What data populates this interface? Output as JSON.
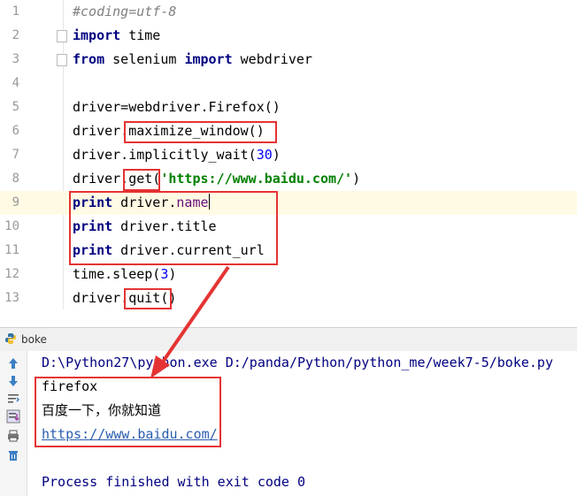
{
  "editor": {
    "lines": [
      {
        "num": "1",
        "segments": [
          {
            "t": "#coding=utf-8",
            "c": "cm"
          }
        ]
      },
      {
        "num": "2",
        "segments": [
          {
            "t": "import",
            "c": "kw"
          },
          {
            "t": " time",
            "c": ""
          }
        ]
      },
      {
        "num": "3",
        "segments": [
          {
            "t": "from",
            "c": "kw"
          },
          {
            "t": " selenium ",
            "c": ""
          },
          {
            "t": "import",
            "c": "kw"
          },
          {
            "t": " webdriver",
            "c": ""
          }
        ]
      },
      {
        "num": "4",
        "segments": []
      },
      {
        "num": "5",
        "segments": [
          {
            "t": "driver=webdriver.Firefox()",
            "c": ""
          }
        ]
      },
      {
        "num": "6",
        "segments": [
          {
            "t": "driver.maximize_window()",
            "c": ""
          }
        ]
      },
      {
        "num": "7",
        "segments": [
          {
            "t": "driver.implicitly_wait(",
            "c": ""
          },
          {
            "t": "30",
            "c": "num"
          },
          {
            "t": ")",
            "c": ""
          }
        ]
      },
      {
        "num": "8",
        "segments": [
          {
            "t": "driver.get(",
            "c": ""
          },
          {
            "t": "'https://www.baidu.com/'",
            "c": "str"
          },
          {
            "t": ")",
            "c": ""
          }
        ]
      },
      {
        "num": "9",
        "segments": [
          {
            "t": "print",
            "c": "kw"
          },
          {
            "t": " driver.",
            "c": ""
          },
          {
            "t": "name",
            "c": "attr"
          }
        ]
      },
      {
        "num": "10",
        "segments": [
          {
            "t": "print",
            "c": "kw"
          },
          {
            "t": " driver.title",
            "c": ""
          }
        ]
      },
      {
        "num": "11",
        "segments": [
          {
            "t": "print",
            "c": "kw"
          },
          {
            "t": " driver.current_url",
            "c": ""
          }
        ]
      },
      {
        "num": "12",
        "segments": [
          {
            "t": "time.sleep(",
            "c": ""
          },
          {
            "t": "3",
            "c": "num"
          },
          {
            "t": ")",
            "c": ""
          }
        ]
      },
      {
        "num": "13",
        "segments": [
          {
            "t": "driver.quit()",
            "c": ""
          }
        ]
      }
    ]
  },
  "run_panel": {
    "tab_label": "boke",
    "command": "D:\\Python27\\python.exe D:/panda/Python/python_me/week7-5/boke.py",
    "output_lines": [
      "firefox",
      "百度一下，你就知道",
      "https://www.baidu.com/"
    ],
    "exit_message": "Process finished with exit code 0"
  },
  "colors": {
    "annotation_red": "#e53333"
  }
}
